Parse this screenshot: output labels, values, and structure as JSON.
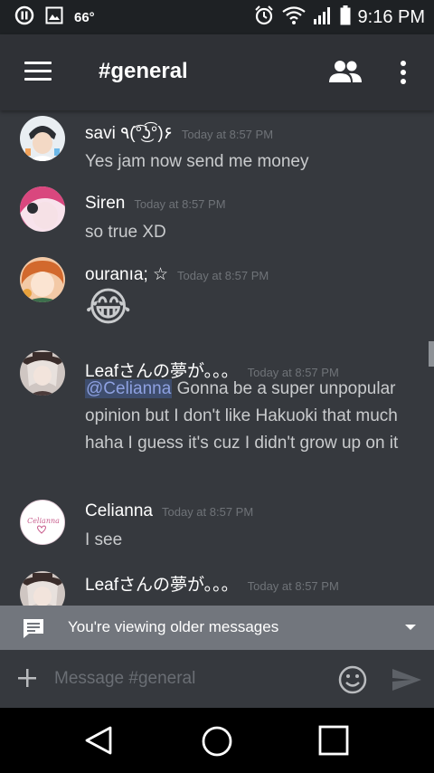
{
  "status_bar": {
    "temperature": "66°",
    "time": "9:16 PM"
  },
  "header": {
    "title": "#general"
  },
  "messages": [
    {
      "author": "savi ٩(͡°͜ʖ͡°)۶",
      "timestamp": "Today at 8:57 PM",
      "text": "Yes jam now send me money"
    },
    {
      "author": "Siren",
      "timestamp": "Today at 8:57 PM",
      "text": "so true XD"
    },
    {
      "author": "ouranıa; ☆",
      "timestamp": "Today at 8:57 PM",
      "emoji": "😂"
    },
    {
      "author": "Leafさんの夢が。。。",
      "timestamp": "Today at 8:57 PM",
      "mention": "@Celianna",
      "text": " Gonna be a super unpopular opinion but I don't like Hakuoki that much haha I guess it's cuz I didn't grow up on it"
    },
    {
      "author": "Celianna",
      "timestamp": "Today at 8:57 PM",
      "text": "I see",
      "avatar_text": "Celianna"
    },
    {
      "author": "Leafさんの夢が。。。",
      "timestamp": "Today at 8:57 PM"
    }
  ],
  "older_banner": {
    "text": "You're viewing older messages"
  },
  "composer": {
    "placeholder": "Message #general"
  },
  "colors": {
    "background": "#36393e",
    "app_bar": "#2f3136",
    "status_bar": "#1e2124",
    "banner": "#72767d",
    "mention": "#8ea1e1"
  }
}
